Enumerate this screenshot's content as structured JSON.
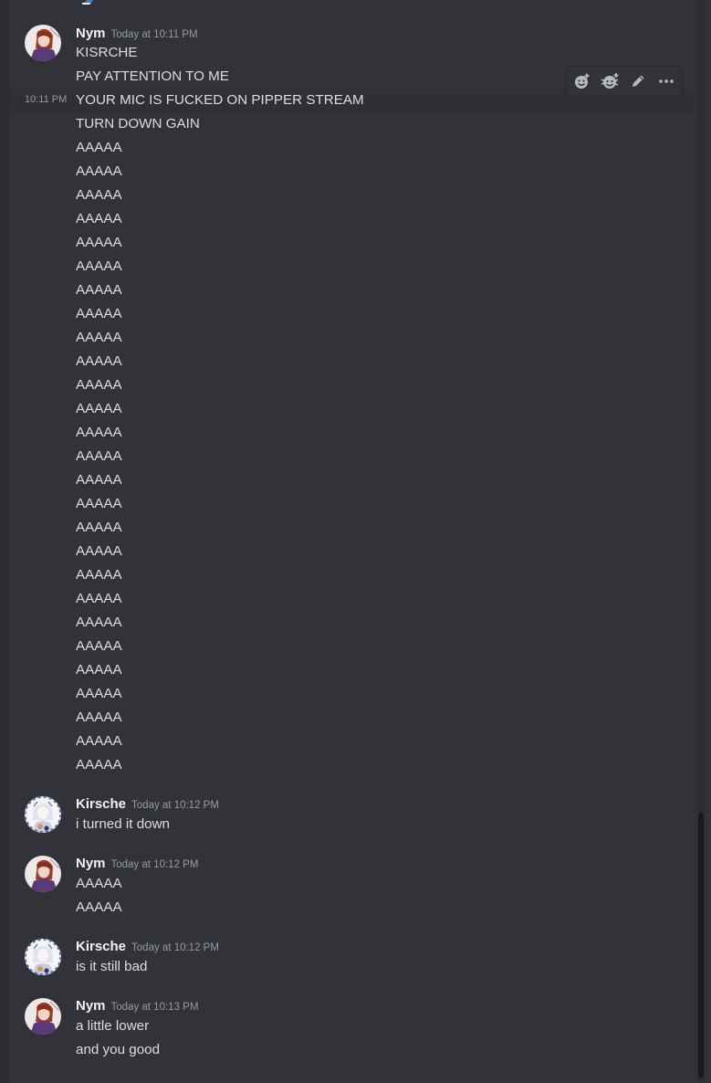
{
  "colors": {
    "background": "#313338",
    "text": "#dbdee1",
    "username": "#f2f3f5",
    "muted": "#949ba4"
  },
  "toolbar": {
    "icons": [
      "add-reaction-icon",
      "super-reaction-icon",
      "edit-icon",
      "more-icon"
    ]
  },
  "messages": [
    {
      "author": "Nym",
      "time": "Today at 10:11 PM",
      "side_time": "10:11 PM",
      "lines": [
        "KISRCHE",
        "PAY ATTENTION TO ME",
        "YOUR MIC IS FUCKED ON PIPPER STREAM",
        "TURN DOWN GAIN",
        "AAAAA",
        "AAAAA",
        "AAAAA",
        "AAAAA",
        "AAAAA",
        "AAAAA",
        "AAAAA",
        "AAAAA",
        "AAAAA",
        "AAAAA",
        "AAAAA",
        "AAAAA",
        "AAAAA",
        "AAAAA",
        "AAAAA",
        "AAAAA",
        "AAAAA",
        "AAAAA",
        "AAAAA",
        "AAAAA",
        "AAAAA",
        "AAAAA",
        "AAAAA",
        "AAAAA",
        "AAAAA",
        "AAAAA",
        "AAAAA"
      ]
    },
    {
      "author": "Kirsche",
      "time": "Today at 10:12 PM",
      "lines": [
        "i turned it down"
      ]
    },
    {
      "author": "Nym",
      "time": "Today at 10:12 PM",
      "lines": [
        "AAAAA",
        "AAAAA"
      ]
    },
    {
      "author": "Kirsche",
      "time": "Today at 10:12 PM",
      "lines": [
        "is it still bad"
      ]
    },
    {
      "author": "Nym",
      "time": "Today at 10:13 PM",
      "lines": [
        "a little lower",
        "and you good"
      ]
    }
  ]
}
